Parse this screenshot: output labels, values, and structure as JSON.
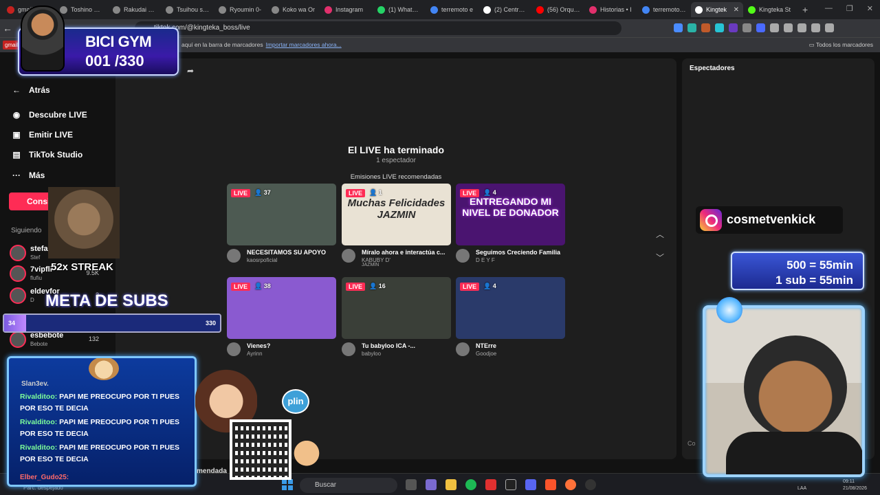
{
  "browser": {
    "tabs": [
      {
        "label": "gmail",
        "color": "#c5221f"
      },
      {
        "label": "Toshino Ma...",
        "color": "#888888"
      },
      {
        "label": "Rakudai Ken",
        "color": "#888888"
      },
      {
        "label": "Tsuihou sare",
        "color": "#888888"
      },
      {
        "label": "Ryoumin 0-",
        "color": "#888888"
      },
      {
        "label": "Koko wa Or",
        "color": "#888888"
      },
      {
        "label": "Instagram",
        "color": "#e1306c"
      },
      {
        "label": "(1) WhatsAp",
        "color": "#25d366"
      },
      {
        "label": "terremoto e",
        "color": "#4285f4"
      },
      {
        "label": "(2) Centro S",
        "color": "#ffffff"
      },
      {
        "label": "(56) Orquest",
        "color": "#ff0000"
      },
      {
        "label": "Historias • I",
        "color": "#e1306c"
      },
      {
        "label": "terremoto m",
        "color": "#4285f4"
      },
      {
        "label": "Kingtek",
        "color": "#ffffff",
        "active": true
      },
      {
        "label": "Kingteka St",
        "color": "#53fc18"
      }
    ],
    "url": "tiktok.com/@kingteka_boss/live",
    "bookmarks_msg": "aquí en la barra de marcadores",
    "bookmarks_link": "Importar marcadores ahora...",
    "bookmarks_all": "Todos los marcadores",
    "bookmark_gmail": "gmail"
  },
  "sidebar": {
    "back": "Atrás",
    "items": [
      {
        "label": "Descubre LIVE",
        "icon": "live-icon"
      },
      {
        "label": "Emitir LIVE",
        "icon": "camera-icon"
      },
      {
        "label": "TikTok Studio",
        "icon": "studio-icon"
      },
      {
        "label": "Más",
        "icon": "more-icon"
      }
    ],
    "consigue_label": "Consi",
    "following_title": "Siguiendo",
    "following": [
      {
        "name": "stefa",
        "sub": "Stef",
        "count": ""
      },
      {
        "name": "7vipfli",
        "sub": "flufiu",
        "count": "9.5K"
      },
      {
        "name": "eldevfor",
        "sub": "D",
        "count": "3"
      },
      {
        "name": "esbebote",
        "sub": "Bebote",
        "count": "132"
      }
    ]
  },
  "main": {
    "ended_title": "El LIVE ha terminado",
    "ended_viewers": "1 espectador",
    "recommended_title": "Emisiones LIVE recomendadas",
    "cards": [
      {
        "badge": "LIVE",
        "viewers": "37",
        "title": "NECESITAMOS SU APOYO",
        "user": "kaosrpoficial",
        "thumb_text": "",
        "thumb_bg": "#4d5a52"
      },
      {
        "badge": "LIVE",
        "viewers": "1",
        "title": "Míralo ahora e interactúa c...",
        "user": "KABUBY D'",
        "user2": "JAZMÍN",
        "thumb_text": "Muchas Felicidades JAZMIN",
        "thumb_bg": "#e9e2d4"
      },
      {
        "badge": "LIVE",
        "viewers": "4",
        "title": "Seguimos Creciendo Familia",
        "user": "D E Y F",
        "thumb_text": "ENTREGANDO MI NIVEL DE DONADOR",
        "thumb_bg": "#4a1470"
      },
      {
        "badge": "LIVE",
        "viewers": "38",
        "title": "Vienes?",
        "user": "Ayrinn",
        "thumb_text": "",
        "thumb_bg": "#8a5ad0"
      },
      {
        "badge": "LIVE",
        "viewers": "16",
        "title": "Tu babyloo ICA -...",
        "user": "babyloo",
        "thumb_text": "",
        "thumb_bg": "#3a3f38"
      },
      {
        "badge": "LIVE",
        "viewers": "4",
        "title": "NTErre",
        "user": "Goodjoe",
        "thumb_text": "",
        "thumb_bg": "#2a3a6a"
      }
    ]
  },
  "right_panel": {
    "title": "Espectadores",
    "comment_placeholder": "Co"
  },
  "overlays": {
    "bicigym_title": "BICI GYM",
    "bicigym_count": "001 /330",
    "streak": "52x STREAK",
    "meta_title": "META DE SUBS",
    "sub_current": "34",
    "sub_goal": "330",
    "chat_top": "Slan3ev.",
    "chat_lines": [
      {
        "user": "Rivalditoo:",
        "text": "PAPI ME PREOCUPO POR TI PUES POR ESO TE DECIA"
      },
      {
        "user": "Rivalditoo:",
        "text": "PAPI ME PREOCUPO POR TI PUES POR ESO TE DECIA"
      },
      {
        "user": "Rivalditoo:",
        "text": "PAPI ME PREOCUPO POR TI PUES POR ESO TE DECIA"
      }
    ],
    "chat_last": "Elber_Gudo25:",
    "plin": "plin",
    "recommended_partial": "mendada",
    "instagram_handle": "cosmetvenkick",
    "rate1": "500 = 55min",
    "rate2": "1 sub = 55min"
  },
  "taskbar": {
    "weather": "Parc. despejado",
    "search_placeholder": "Buscar",
    "lang": "LAA",
    "time": "09:11",
    "date": "21/08/2026"
  }
}
